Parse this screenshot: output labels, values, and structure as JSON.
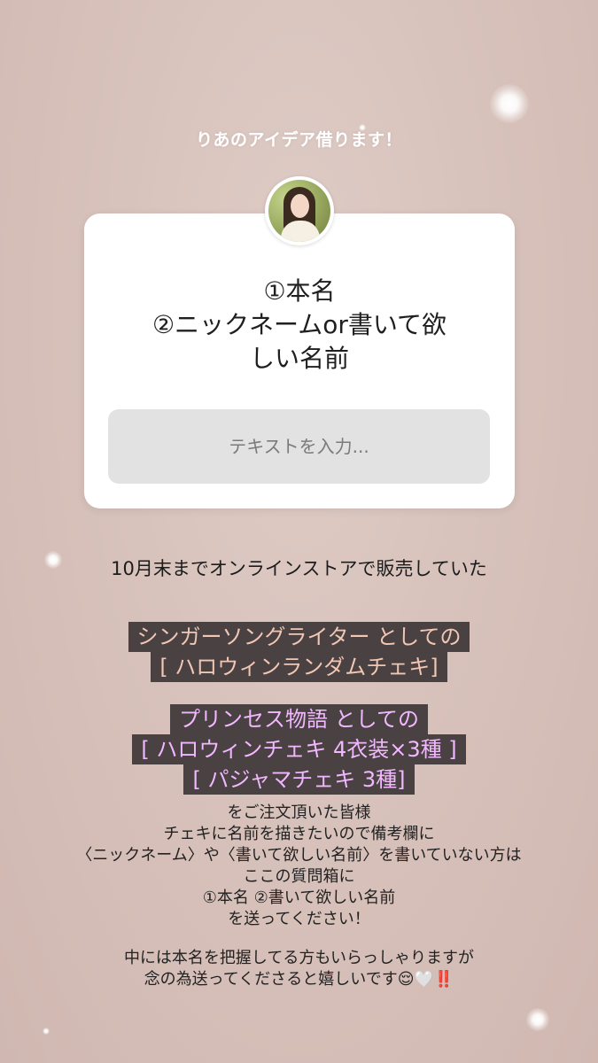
{
  "story": {
    "caption": "りあのアイデア借ります！",
    "question_lines": [
      "①本名",
      "②ニックネームor書いて欲",
      "しい名前"
    ],
    "answer_placeholder": "テキストを入力..."
  },
  "body": {
    "intro": "10月末までオンラインストアで販売していた",
    "highlight_a": [
      "シンガーソングライター としての",
      "[ ハロウィンランダムチェキ]"
    ],
    "highlight_b": [
      "プリンセス物語 としての",
      "[ ハロウィンチェキ 4衣装×3種 ]",
      "[ パジャマチェキ 3種]"
    ],
    "paragraph_1": [
      "をご注文頂いた皆様",
      "チェキに名前を描きたいので備考欄に",
      "〈ニックネーム〉や〈書いて欲しい名前〉を書いていない方は",
      "ここの質問箱に",
      "①本名 ②書いて欲しい名前",
      "を送ってください！"
    ],
    "paragraph_2": [
      "中には本名を把握してる方もいらっしゃりますが",
      "念の為送ってくださると嬉しいです😌🤍‼️"
    ]
  },
  "colors": {
    "background": "#d8c3bc",
    "highlight_bg": "#4a4142",
    "highlight_a_text": "#f1c7b4",
    "highlight_b_text": "#f2b8ff"
  }
}
